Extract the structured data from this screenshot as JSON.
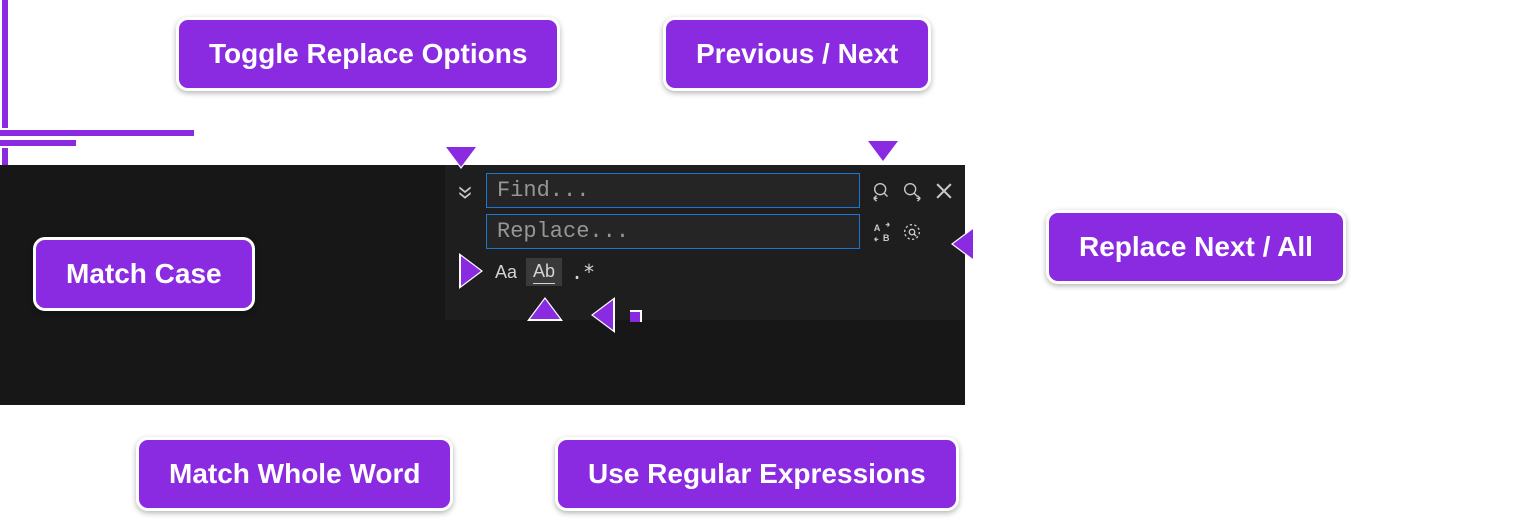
{
  "callouts": {
    "toggle_replace": "Toggle Replace Options",
    "previous_next": "Previous / Next",
    "match_case": "Match Case",
    "replace_next_all": "Replace Next / All",
    "match_whole_word": "Match Whole Word",
    "use_regex": "Use Regular Expressions"
  },
  "widget": {
    "find_placeholder": "Find...",
    "replace_placeholder": "Replace...",
    "match_case_label": "Aa",
    "match_word_label": "Ab",
    "regex_label": ".*"
  }
}
